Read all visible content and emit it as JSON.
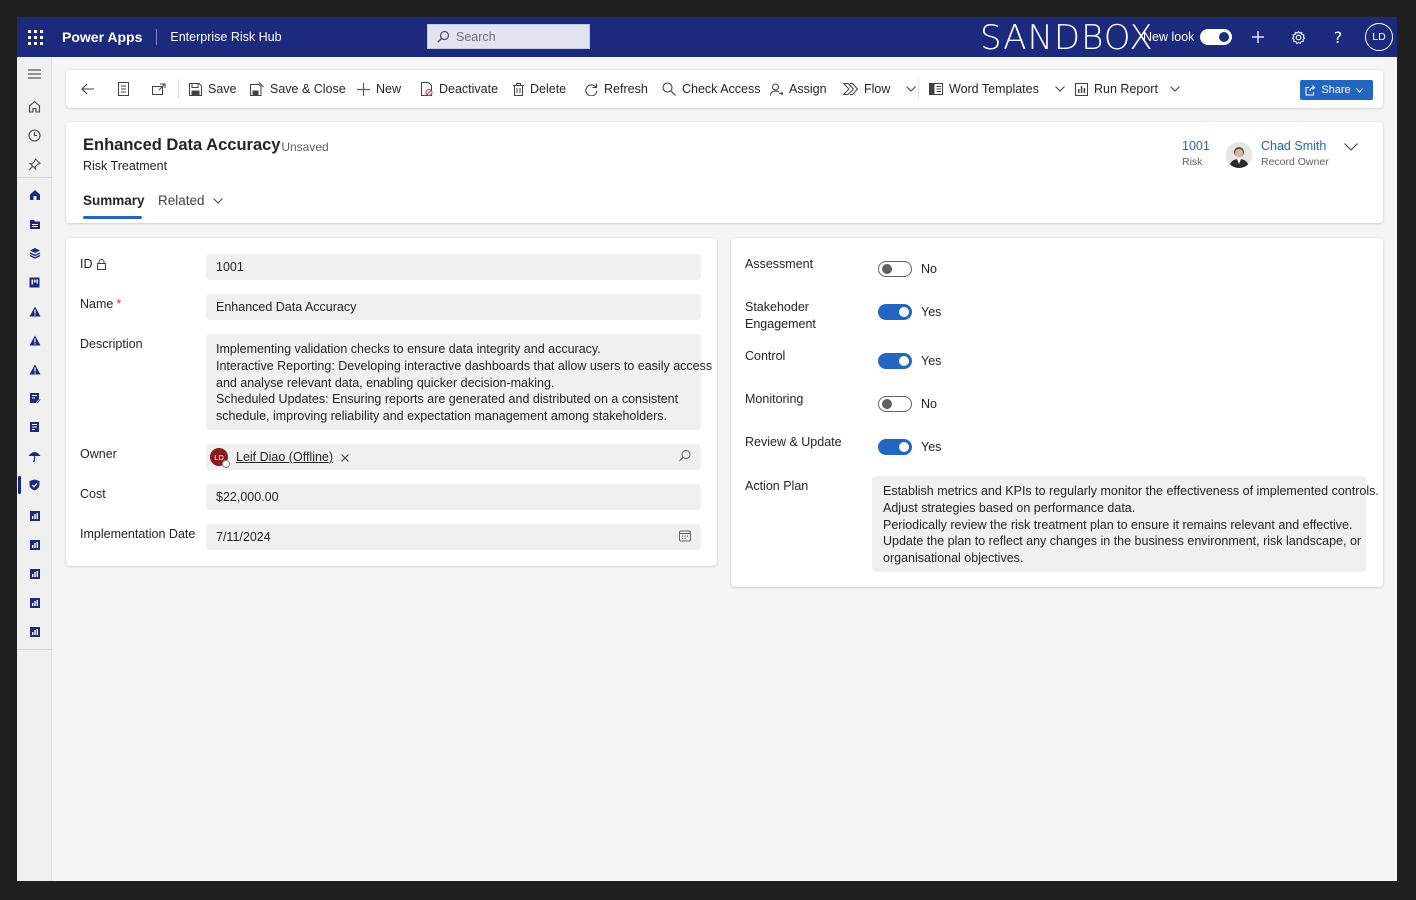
{
  "topbar": {
    "app_name": "Power Apps",
    "environment": "Enterprise Risk Hub",
    "search_placeholder": "Search",
    "sandbox_label": "SANDBOX",
    "new_look_label": "New look",
    "new_look_on": true,
    "user_initials": "LD"
  },
  "commands": {
    "save": "Save",
    "save_close": "Save & Close",
    "new": "New",
    "deactivate": "Deactivate",
    "delete": "Delete",
    "refresh": "Refresh",
    "check_access": "Check Access",
    "assign": "Assign",
    "flow": "Flow",
    "word_templates": "Word Templates",
    "run_report": "Run Report",
    "share": "Share"
  },
  "header": {
    "title": "Enhanced Data Accuracy",
    "unsaved": "- Unsaved",
    "entity": "Risk Treatment",
    "risk_value": "1001",
    "risk_label": "Risk",
    "owner_name": "Chad Smith",
    "owner_label": "Record Owner",
    "tabs": [
      "Summary",
      "Related"
    ]
  },
  "form_left": {
    "id_label": "ID",
    "id_value": "1001",
    "name_label": "Name",
    "name_required": "*",
    "name_value": "Enhanced Data Accuracy",
    "description_label": "Description",
    "description_lines": [
      "Implementing validation checks to ensure data integrity and accuracy.",
      "Interactive Reporting: Developing interactive dashboards that allow users to easily access",
      "and analyse relevant data, enabling quicker decision-making.",
      "Scheduled Updates: Ensuring reports are generated and distributed on a consistent",
      "schedule, improving reliability and expectation management among stakeholders."
    ],
    "owner_label": "Owner",
    "owner_initials": "LD",
    "owner_value": "Leif Diao (Offline)",
    "cost_label": "Cost",
    "cost_value": "$22,000.00",
    "impl_date_label": "Implementation Date",
    "impl_date_value": "7/11/2024"
  },
  "form_right": {
    "assessment_label": "Assessment",
    "assessment_value": "No",
    "assessment_on": false,
    "stakeholder_label_1": "Stakehoder",
    "stakeholder_label_2": "Engagement",
    "stakeholder_value": "Yes",
    "stakeholder_on": true,
    "control_label": "Control",
    "control_value": "Yes",
    "control_on": true,
    "monitoring_label": "Monitoring",
    "monitoring_value": "No",
    "monitoring_on": false,
    "review_label": "Review & Update",
    "review_value": "Yes",
    "review_on": true,
    "action_plan_label": "Action Plan",
    "action_plan_lines": [
      "Establish metrics and KPIs to regularly monitor the effectiveness of implemented controls.",
      "Adjust strategies based on performance data.",
      "Periodically review the risk treatment plan to ensure it remains relevant and effective.",
      "Update the plan to reflect any changes in the business environment, risk landscape, or",
      "organisational objectives."
    ]
  },
  "colors": {
    "topbar": "#1b2a7d",
    "accent": "#2266c2",
    "required": "#c4314b"
  },
  "icons": {
    "nav": [
      "menu-icon",
      "home-icon",
      "recent-icon",
      "pin-icon",
      "dashboard-icon",
      "folder-icon",
      "layers-icon",
      "board-icon",
      "warning-icon",
      "warning-icon",
      "warning-icon",
      "report-icon",
      "report-icon",
      "umbrella-icon",
      "shield-icon",
      "chart-icon",
      "chart-icon",
      "chart-icon",
      "chart-icon",
      "chart-icon"
    ]
  }
}
